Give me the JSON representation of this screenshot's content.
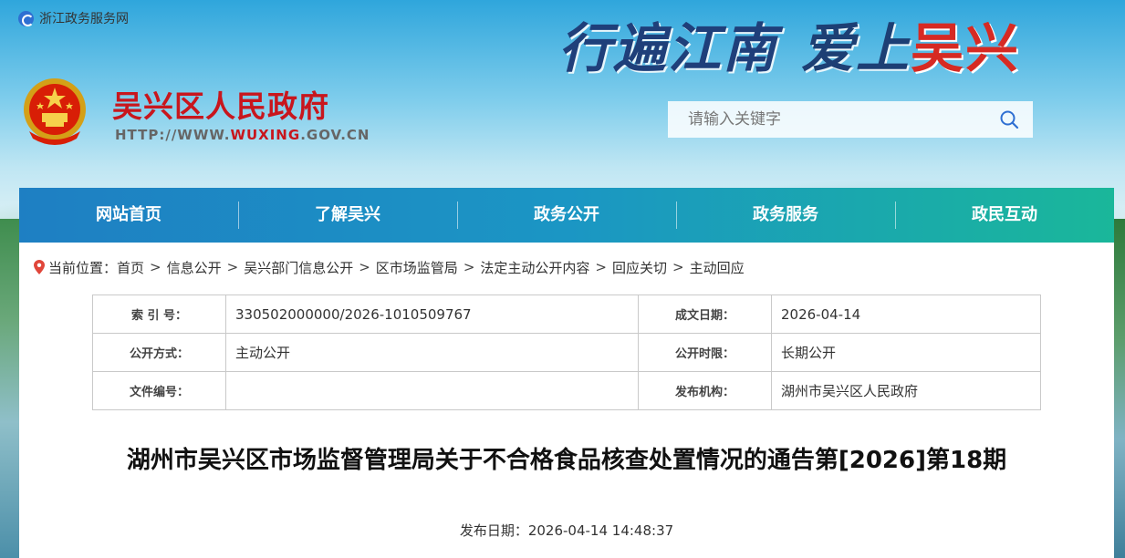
{
  "topbar": {
    "label": "浙江政务服务网"
  },
  "slogan": {
    "part1": "行遍江南",
    "part2": "爱上",
    "part3": "吴兴"
  },
  "site": {
    "title": "吴兴区人民政府",
    "url_prefix": "HTTP://WWW.",
    "url_highlight": "WUXING",
    "url_suffix": ".GOV.CN"
  },
  "search": {
    "placeholder": "请输入关键字"
  },
  "nav": {
    "items": [
      "网站首页",
      "了解吴兴",
      "政务公开",
      "政务服务",
      "政民互动"
    ]
  },
  "breadcrumb": {
    "label": "当前位置：",
    "items": [
      "首页",
      "信息公开",
      "吴兴部门信息公开",
      "区市场监管局",
      "法定主动公开内容",
      "回应关切",
      "主动回应"
    ],
    "separator": ">"
  },
  "meta": {
    "rows": [
      {
        "label1": "索 引 号：",
        "value1": "330502000000/2026-1010509767",
        "label2": "成文日期：",
        "value2": "2026-04-14"
      },
      {
        "label1": "公开方式：",
        "value1": "主动公开",
        "label2": "公开时限：",
        "value2": "长期公开"
      },
      {
        "label1": "文件编号：",
        "value1": "",
        "label2": "发布机构：",
        "value2": "湖州市吴兴区人民政府"
      }
    ]
  },
  "article": {
    "title": "湖州市吴兴区市场监督管理局关于不合格食品核查处置情况的通告第[2026]第18期",
    "pub_date_label": "发布日期：",
    "pub_date": "2026-04-14 14:48:37"
  },
  "colors": {
    "brand_red": "#c8161d",
    "nav_start": "#1e7fc3",
    "nav_end": "#1ab79a"
  }
}
